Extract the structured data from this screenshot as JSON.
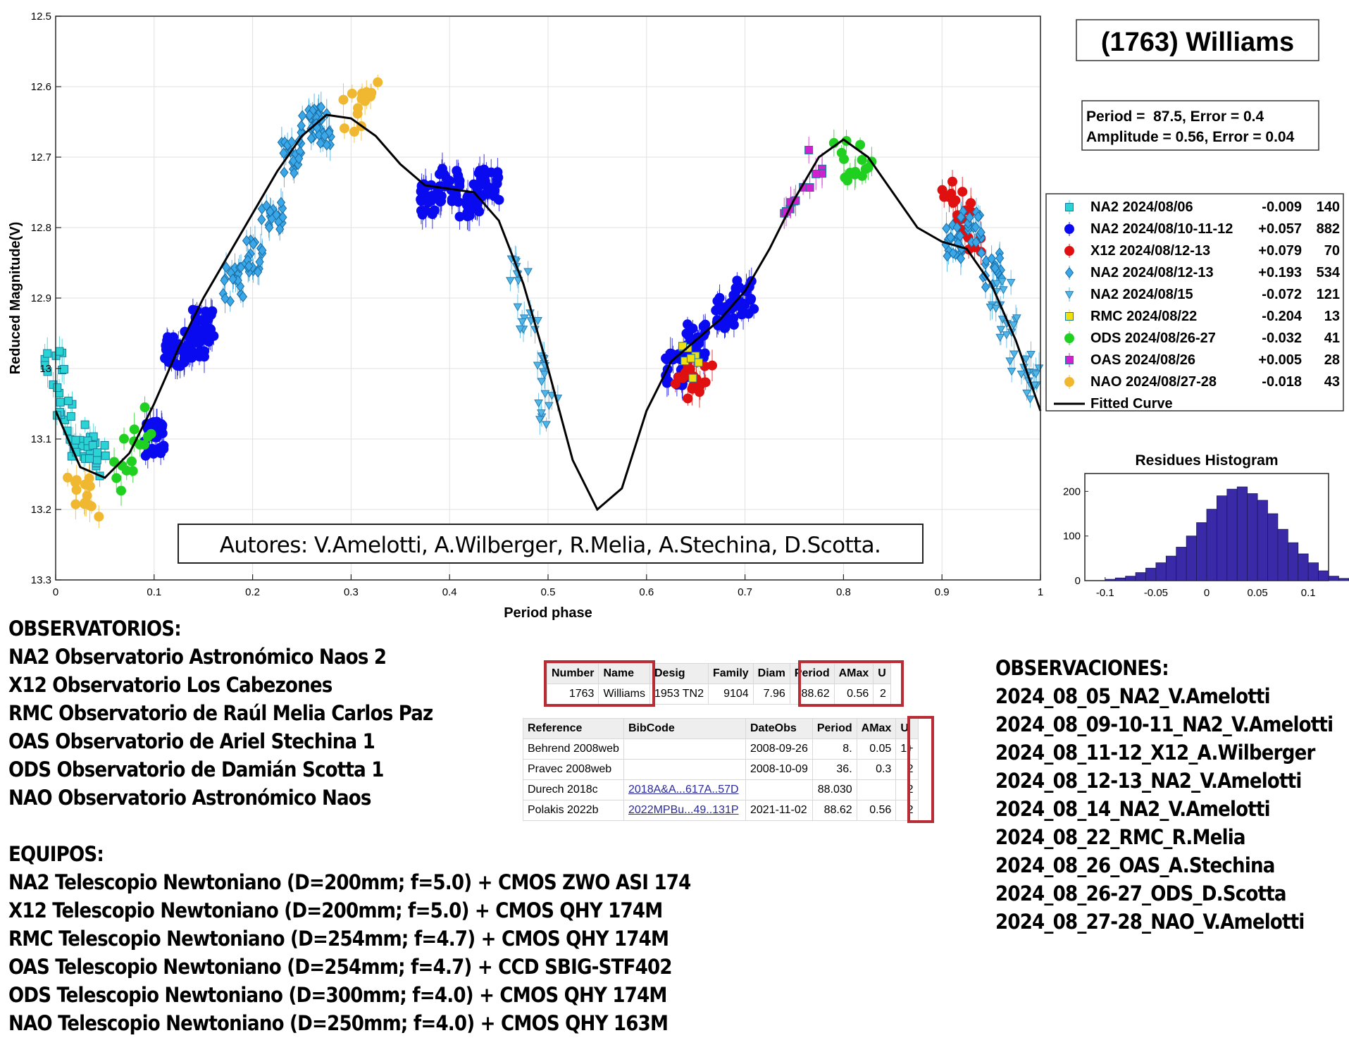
{
  "chart_data": {
    "type": "scatter",
    "title": "(1763) Williams",
    "xlabel": "Period phase",
    "ylabel": "Reduced Magnitude(V)",
    "xlim": [
      0,
      1
    ],
    "ylim": [
      12.5,
      13.3
    ],
    "y_reversed": true,
    "xticks": [
      "0",
      "0.1",
      "0.2",
      "0.3",
      "0.4",
      "0.5",
      "0.6",
      "0.7",
      "0.8",
      "0.9",
      "1"
    ],
    "yticks": [
      "12.5",
      "12.6",
      "12.7",
      "12.8",
      "12.9",
      "13",
      "13.1",
      "13.2",
      "13.3"
    ],
    "grid": true,
    "fit_info": [
      "Period =  87.5, Error = 0.4",
      "Amplitude = 0.56, Error = 0.04"
    ],
    "legend_position": "right",
    "series": [
      {
        "name": "NA2 2024/08/06",
        "offset": "-0.009",
        "count": "140",
        "marker": "square",
        "color": "#2ad4d4",
        "x": [
          0.0,
          0.01,
          0.02,
          0.03,
          0.04
        ],
        "y": [
          13.0,
          13.05,
          13.1,
          13.12,
          13.13
        ]
      },
      {
        "name": "NA2 2024/08/10-11-12",
        "offset": "+0.057",
        "count": "882",
        "marker": "circle",
        "color": "#0a0af0",
        "x": [
          0.1,
          0.12,
          0.14,
          0.15,
          0.38,
          0.4,
          0.42,
          0.44,
          0.63,
          0.65,
          0.68,
          0.7
        ],
        "y": [
          13.1,
          12.98,
          12.96,
          12.94,
          12.76,
          12.74,
          12.76,
          12.74,
          13.0,
          12.96,
          12.92,
          12.9
        ]
      },
      {
        "name": "X12 2024/08/12-13",
        "offset": "+0.079",
        "count": "70",
        "marker": "circle",
        "color": "#e01010",
        "x": [
          0.64,
          0.65,
          0.66,
          0.91,
          0.92,
          0.93
        ],
        "y": [
          13.02,
          13.01,
          13.0,
          12.75,
          12.78,
          12.82
        ]
      },
      {
        "name": "NA2 2024/08/12-13",
        "offset": "+0.193",
        "count": "534",
        "marker": "diamond",
        "color": "#3aa8e8",
        "x": [
          0.18,
          0.2,
          0.22,
          0.24,
          0.26,
          0.27,
          0.91,
          0.93,
          0.95
        ],
        "y": [
          12.88,
          12.84,
          12.78,
          12.7,
          12.64,
          12.66,
          12.82,
          12.8,
          12.86
        ]
      },
      {
        "name": "NA2 2024/08/15",
        "offset": "-0.072",
        "count": "121",
        "marker": "triangle-down",
        "color": "#4fb8e8",
        "x": [
          0.47,
          0.48,
          0.49,
          0.5,
          0.96,
          0.97,
          0.98,
          0.99
        ],
        "y": [
          12.86,
          12.92,
          13.0,
          13.06,
          12.9,
          12.95,
          13.0,
          13.02
        ]
      },
      {
        "name": "RMC 2024/08/22",
        "offset": "-0.204",
        "count": "13",
        "marker": "square",
        "color": "#f0e010",
        "x": [
          0.64,
          0.645
        ],
        "y": [
          12.98,
          13.0
        ]
      },
      {
        "name": "ODS 2024/08/26-27",
        "offset": "-0.032",
        "count": "41",
        "marker": "circle",
        "color": "#20d020",
        "x": [
          0.07,
          0.08,
          0.09,
          0.8,
          0.81,
          0.82
        ],
        "y": [
          13.15,
          13.12,
          13.08,
          12.7,
          12.72,
          12.7
        ]
      },
      {
        "name": "OAS 2024/08/26",
        "offset": "+0.005",
        "count": "28",
        "marker": "square",
        "color": "#d020d0",
        "x": [
          0.74,
          0.755,
          0.77
        ],
        "y": [
          12.77,
          12.74,
          12.71
        ]
      },
      {
        "name": "NAO 2024/08/27-28",
        "offset": "-0.018",
        "count": "43",
        "marker": "circle",
        "color": "#f0b830",
        "x": [
          0.02,
          0.03,
          0.04,
          0.3,
          0.31,
          0.32
        ],
        "y": [
          13.17,
          13.18,
          13.19,
          12.64,
          12.62,
          12.6
        ]
      }
    ],
    "fitted_curve": {
      "name": "Fitted Curve",
      "x": [
        0.0,
        0.025,
        0.05,
        0.075,
        0.1,
        0.125,
        0.15,
        0.175,
        0.2,
        0.225,
        0.25,
        0.275,
        0.3,
        0.325,
        0.35,
        0.375,
        0.4,
        0.425,
        0.45,
        0.475,
        0.5,
        0.525,
        0.55,
        0.575,
        0.6,
        0.625,
        0.65,
        0.675,
        0.7,
        0.725,
        0.75,
        0.775,
        0.8,
        0.825,
        0.85,
        0.875,
        0.9,
        0.925,
        0.95,
        0.975,
        1.0
      ],
      "y": [
        13.06,
        13.14,
        13.155,
        13.12,
        13.05,
        12.97,
        12.9,
        12.84,
        12.78,
        12.72,
        12.67,
        12.64,
        12.645,
        12.67,
        12.71,
        12.74,
        12.745,
        12.75,
        12.79,
        12.88,
        13.0,
        13.13,
        13.2,
        13.17,
        13.06,
        12.99,
        12.96,
        12.93,
        12.89,
        12.83,
        12.76,
        12.7,
        12.675,
        12.7,
        12.75,
        12.8,
        12.82,
        12.83,
        12.88,
        12.96,
        13.06
      ]
    },
    "histogram": {
      "title": "Residues Histogram",
      "xlim": [
        -0.12,
        0.12
      ],
      "ylim": [
        0,
        240
      ],
      "xticks": [
        "-0.1",
        "-0.05",
        "0",
        "0.05",
        "0.1"
      ],
      "yticks": [
        "0",
        "100",
        "200"
      ],
      "bin_start": -0.1,
      "bin_width": 0.01,
      "values": [
        3,
        6,
        10,
        18,
        28,
        40,
        55,
        75,
        100,
        130,
        160,
        190,
        205,
        210,
        195,
        180,
        150,
        115,
        85,
        60,
        40,
        22,
        10,
        5,
        2
      ]
    },
    "annotation": "Autores: V.Amelotti, A.Wilberger, R.Melia, A.Stechina, D.Scotta."
  },
  "observatorios": {
    "heading": "OBSERVATORIOS:",
    "items": [
      "NA2 Observatorio Astronómico Naos 2",
      "X12 Observatorio Los Cabezones",
      "RMC Observatorio de Raúl Melia Carlos Paz",
      "OAS Observatorio de Ariel Stechina 1",
      "ODS Observatorio de Damián Scotta 1",
      "NAO Observatorio Astronómico Naos"
    ]
  },
  "equipos": {
    "heading": "EQUIPOS:",
    "items": [
      "NA2 Telescopio Newtoniano (D=200mm; f=5.0) + CMOS ZWO ASI 174",
      "X12 Telescopio Newtoniano (D=200mm; f=5.0) + CMOS QHY 174M",
      "RMC Telescopio Newtoniano (D=254mm; f=4.7) + CMOS QHY 174M",
      "OAS Telescopio Newtoniano (D=254mm; f=4.7) + CCD SBIG-STF402",
      "ODS Telescopio Newtoniano (D=300mm; f=4.0) + CMOS QHY 174M",
      "NAO Telescopio Newtoniano (D=250mm; f=4.0) + CMOS QHY 163M"
    ]
  },
  "observaciones": {
    "heading": "OBSERVACIONES:",
    "items": [
      "2024_08_05_NA2_V.Amelotti",
      "2024_08_09-10-11_NA2_V.Amelotti",
      "2024_08_11-12_X12_A.Wilberger",
      "2024_08_12-13_NA2_V.Amelotti",
      "2024_08_14_NA2_V.Amelotti",
      "2024_08_22_RMC_R.Melia",
      "2024_08_26_OAS_A.Stechina",
      "2024_08_26-27_ODS_D.Scotta",
      "2024_08_27-28_NAO_V.Amelotti"
    ]
  },
  "summary_table": {
    "headers": [
      "Number",
      "Name",
      "Desig",
      "Family",
      "Diam",
      "Period",
      "AMax",
      "U"
    ],
    "row": [
      "1763",
      "Williams",
      "1953 TN2",
      "9104",
      "7.96",
      "88.62",
      "0.56",
      "2"
    ]
  },
  "reference_table": {
    "headers": [
      "Reference",
      "BibCode",
      "DateObs",
      "Period",
      "AMax",
      "U"
    ],
    "rows": [
      [
        "Behrend 2008web",
        "",
        "2008-09-26",
        "8.",
        "0.05",
        "1+"
      ],
      [
        "Pravec 2008web",
        "",
        "2008-10-09",
        "36.",
        "0.3",
        "2"
      ],
      [
        "Durech 2018c",
        "2018A&A...617A..57D",
        "",
        "88.030",
        "",
        "2"
      ],
      [
        "Polakis 2022b",
        "2022MPBu...49..131P",
        "2021-11-02",
        "88.62",
        "0.56",
        "2"
      ]
    ]
  }
}
